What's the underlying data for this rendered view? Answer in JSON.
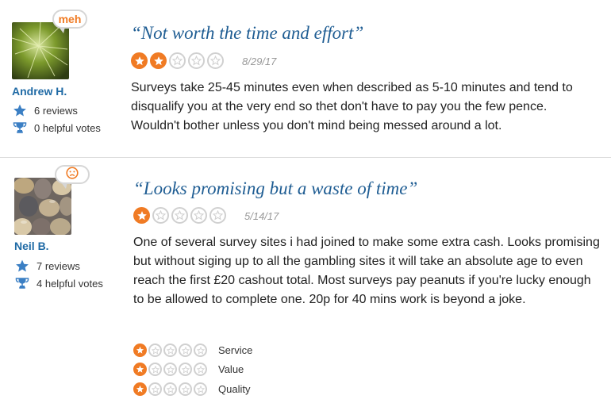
{
  "reviews": [
    {
      "badge": "meh",
      "username": "Andrew H.",
      "reviews_count": "6 reviews",
      "helpful_votes": "0 helpful votes",
      "title": "“Not worth the time and effort”",
      "rating": 2,
      "date": "8/29/17",
      "body": "Surveys take 25-45 minutes even when described as 5-10 minutes and tend to disqualify you at the very end so thet don't have to pay you the few pence. Wouldn't bother unless you don't mind being messed around a lot."
    },
    {
      "badge": "sad-face-icon",
      "username": "Neil B.",
      "reviews_count": "7 reviews",
      "helpful_votes": "4 helpful votes",
      "title": "“Looks promising but a waste of time”",
      "rating": 1,
      "date": "5/14/17",
      "body": "One of several survey sites i had joined to make some extra cash. Looks promising but without siging up to all the gambling sites it will take an absolute age to even reach the first £20 cashout total. Most surveys pay peanuts if you're lucky enough to be allowed to complete one. 20p for 40 mins work is beyond a joke.",
      "sub_ratings": [
        {
          "label": "Service",
          "rating": 1
        },
        {
          "label": "Value",
          "rating": 1
        },
        {
          "label": "Quality",
          "rating": 1
        }
      ]
    }
  ],
  "colors": {
    "accent": "#f07b24",
    "title": "#1f5d93",
    "username": "#1f6aa5",
    "icon_blue": "#3b7fc4"
  }
}
